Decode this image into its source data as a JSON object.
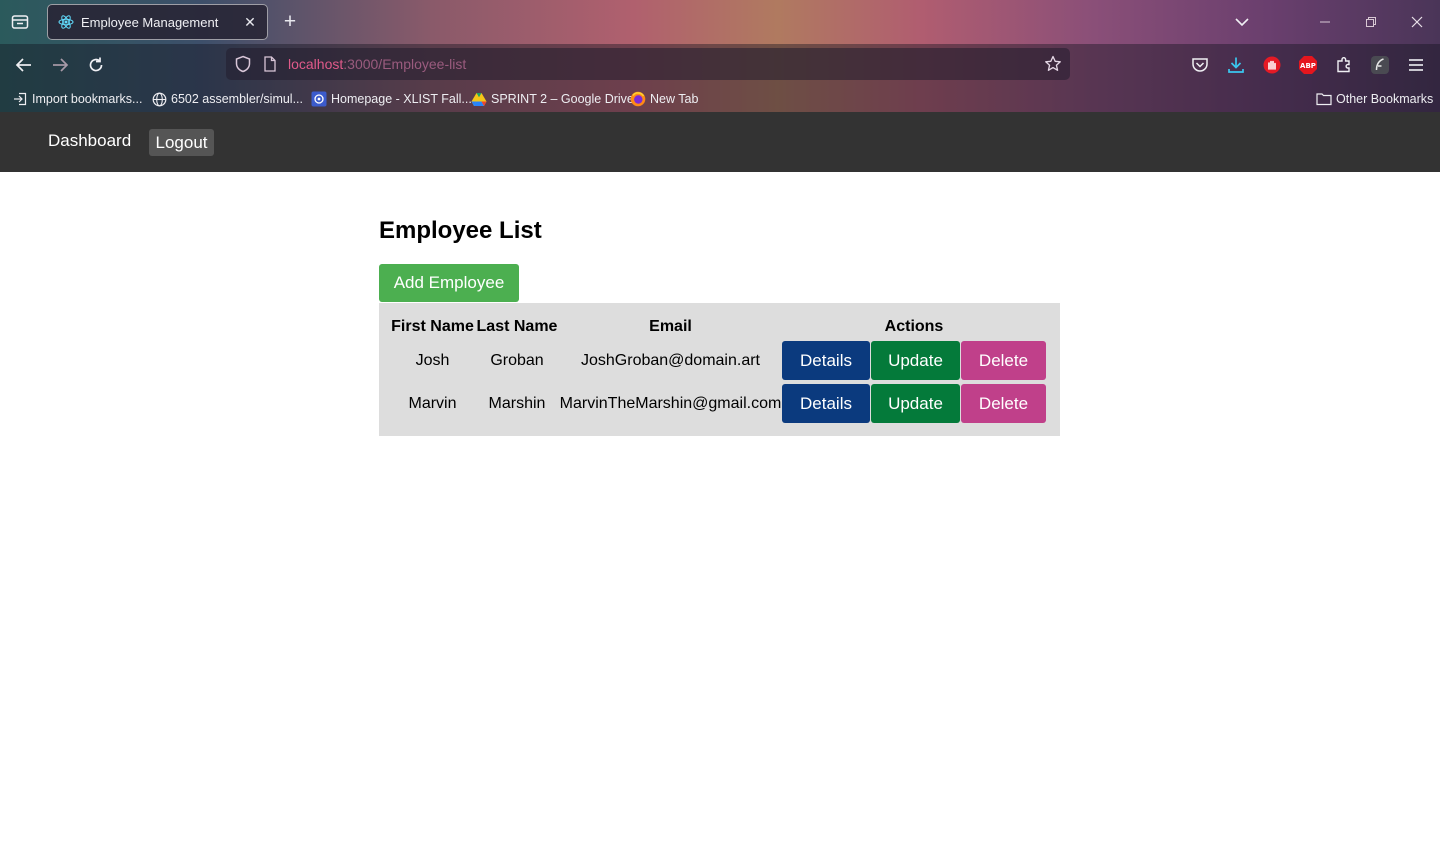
{
  "browser": {
    "tab_title": "Employee Management",
    "new_tab_symbol": "+",
    "tab_close_symbol": "✕",
    "url_host": "localhost",
    "url_path": ":3000/Employee-list",
    "bookmarks": [
      {
        "label": "Import bookmarks...",
        "icon": "import-icon"
      },
      {
        "label": "6502 assembler/simul...",
        "icon": "globe-icon"
      },
      {
        "label": "Homepage - XLIST Fall...",
        "icon": "xlist-icon"
      },
      {
        "label": "SPRINT 2 – Google Drive",
        "icon": "google-drive-icon"
      },
      {
        "label": "New Tab",
        "icon": "firefox-icon"
      }
    ],
    "other_bookmarks": "Other Bookmarks"
  },
  "app": {
    "nav": {
      "dashboard": "Dashboard",
      "logout": "Logout"
    },
    "page_title": "Employee List",
    "add_button": "Add Employee",
    "table": {
      "headers": [
        "First Name",
        "Last Name",
        "Email",
        "Actions"
      ],
      "rows": [
        {
          "first": "Josh",
          "last": "Groban",
          "email": "JoshGroban@domain.art"
        },
        {
          "first": "Marvin",
          "last": "Marshin",
          "email": "MarvinTheMarshin@gmail.com"
        }
      ],
      "actions": {
        "details": "Details",
        "update": "Update",
        "delete": "Delete"
      }
    }
  },
  "colors": {
    "app_nav": "#333333",
    "add_button": "#4caf50",
    "details": "#0b3a7e",
    "update": "#047a3a",
    "delete": "#c0408a",
    "table_bg": "#dddddd"
  }
}
